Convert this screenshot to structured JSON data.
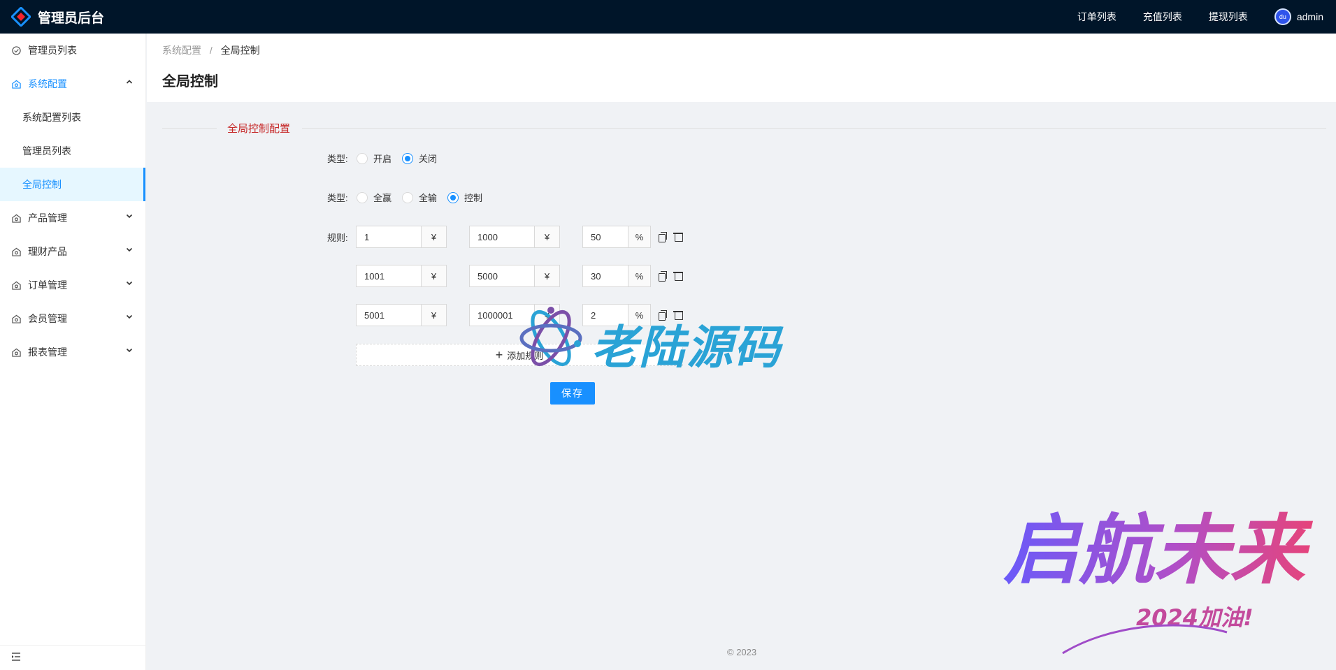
{
  "header": {
    "app_title": "管理员后台",
    "nav": [
      "订单列表",
      "充值列表",
      "提现列表"
    ],
    "user_name": "admin",
    "avatar_text": "du"
  },
  "sidebar": {
    "items": [
      {
        "label": "管理员列表",
        "icon": "check-circle-icon"
      },
      {
        "label": "系统配置",
        "icon": "settings-icon",
        "open": true,
        "children": [
          "系统配置列表",
          "管理员列表",
          "全局控制"
        ]
      },
      {
        "label": "产品管理",
        "icon": "home-icon"
      },
      {
        "label": "理财产品",
        "icon": "home-icon"
      },
      {
        "label": "订单管理",
        "icon": "home-icon"
      },
      {
        "label": "会员管理",
        "icon": "home-icon"
      },
      {
        "label": "报表管理",
        "icon": "home-icon"
      }
    ],
    "active_child": "全局控制"
  },
  "breadcrumb": {
    "parent": "系统配置",
    "separator": "/",
    "current": "全局控制"
  },
  "page_title": "全局控制",
  "section_title": "全局控制配置",
  "form": {
    "switch": {
      "label": "类型:",
      "options": [
        "开启",
        "关闭"
      ],
      "selected": "关闭"
    },
    "mode": {
      "label": "类型:",
      "options": [
        "全赢",
        "全输",
        "控制"
      ],
      "selected": "控制"
    },
    "rules_label": "规则:",
    "currency": "¥",
    "percent": "%",
    "rules": [
      {
        "min": "1",
        "max": "1000",
        "rate": "50"
      },
      {
        "min": "1001",
        "max": "5000",
        "rate": "30"
      },
      {
        "min": "5001",
        "max": "1000001",
        "rate": "2"
      }
    ],
    "add_rule_label": "添加规则",
    "save_label": "保存"
  },
  "footer": "© 2023",
  "watermark": {
    "text": "老陆源码",
    "color": "#2aa3d6"
  },
  "decoration": {
    "text": "启航未来",
    "subtext": "2024加油!"
  },
  "colors": {
    "header_bg": "#001529",
    "primary": "#1890ff",
    "section_title": "#c62828"
  }
}
